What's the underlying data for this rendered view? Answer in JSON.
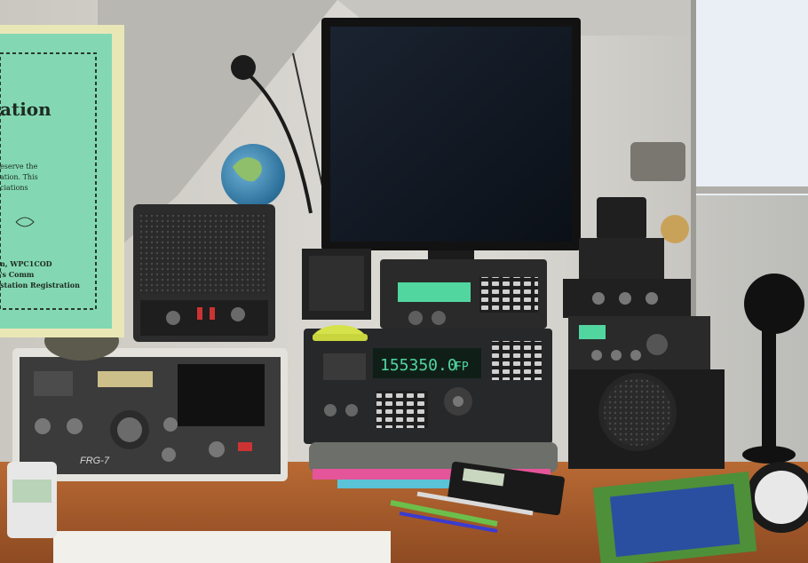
{
  "booklet": {
    "title_fragment": "ation",
    "lines": [
      "eserve the",
      "ation. This",
      "ciations"
    ],
    "author_lines": [
      "n, WPC1COD",
      "'s Comm",
      "station Registration"
    ]
  },
  "receiver_main": {
    "display": "155350.0",
    "display_suffix": "FP"
  },
  "transceiver_left": {
    "model": "FRG-7"
  },
  "colors": {
    "booklet": "#83d8b3",
    "booklet_border": "#e9e7b6",
    "wall": "#d6d4cd",
    "desk": "#a85c2c",
    "radio_dark": "#26282a",
    "display_green": "#51d6a0"
  }
}
